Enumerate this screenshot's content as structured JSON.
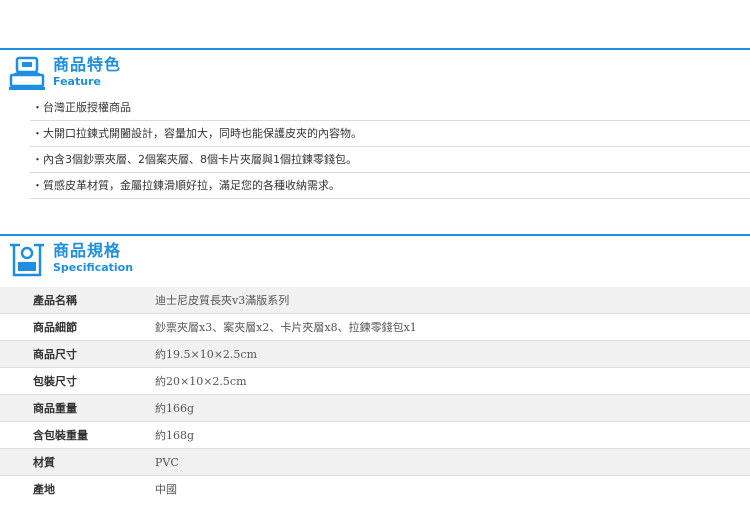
{
  "feature": {
    "title": "商品特色",
    "subtitle": "Feature",
    "items": [
      "・台灣正版授權商品",
      "・大開口拉鍊式開闔設計，容量加大，同時也能保護皮夾的內容物。",
      "・內含3個鈔票夾層、2個案夾層、8個卡片夾層與1個拉鍊零錢包。",
      "・質感皮革材質，金屬拉鍊滑順好拉，滿足您的各種收納需求。"
    ]
  },
  "spec": {
    "title": "商品規格",
    "subtitle": "Specification",
    "rows": [
      {
        "label": "產品名稱",
        "value": "迪士尼皮質長夾v3滿版系列"
      },
      {
        "label": "商品細節",
        "value": "鈔票夾層x3、案夾層x2、卡片夾層x8、拉鍊零錢包x1"
      },
      {
        "label": "商品尺寸",
        "value": "約19.5×10×2.5cm"
      },
      {
        "label": "包裝尺寸",
        "value": "約20×10×2.5cm"
      },
      {
        "label": "商品重量",
        "value": "約166g"
      },
      {
        "label": "含包裝重量",
        "value": "約168g"
      },
      {
        "label": "材質",
        "value": "PVC"
      },
      {
        "label": "產地",
        "value": "中國"
      }
    ]
  },
  "colors": {
    "accent": "#1e8fe0",
    "row_shade": "#f1f1f1",
    "divider": "#dcdcdc"
  },
  "icons": {
    "feature": "register-icon",
    "spec": "box-icon"
  }
}
